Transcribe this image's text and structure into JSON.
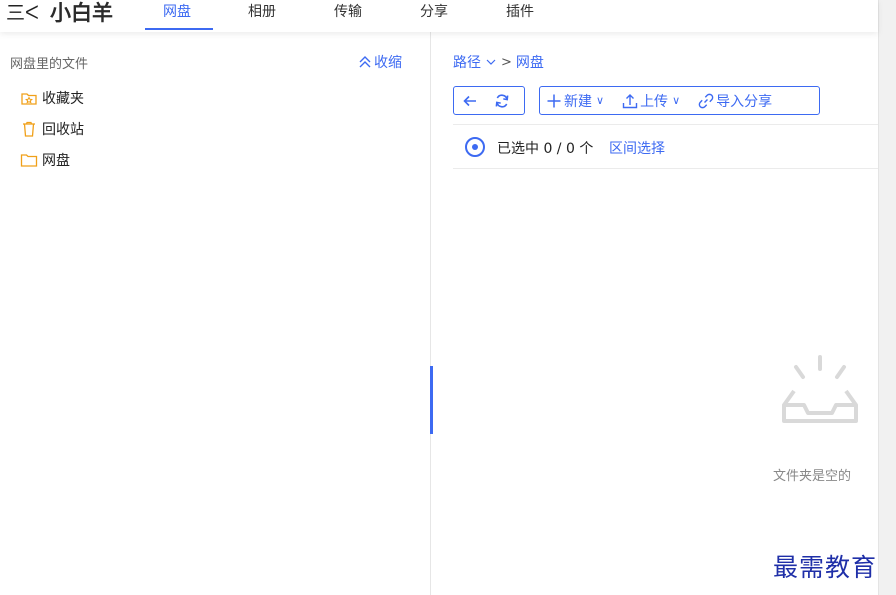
{
  "header": {
    "menu_icon": "三ᐸ",
    "brand": "小白羊",
    "tabs": [
      {
        "label": "网盘",
        "active": true
      },
      {
        "label": "相册"
      },
      {
        "label": "传输"
      },
      {
        "label": "分享"
      },
      {
        "label": "插件"
      }
    ]
  },
  "sidebar": {
    "title": "网盘里的文件",
    "collapse_label": "收缩",
    "items": [
      {
        "label": "收藏夹",
        "icon": "favorites-folder-icon"
      },
      {
        "label": "回收站",
        "icon": "trash-icon"
      },
      {
        "label": "网盘",
        "icon": "folder-icon"
      }
    ]
  },
  "breadcrumb": {
    "path_label": "路径",
    "current": "网盘"
  },
  "toolbar": {
    "new_label": "新建",
    "upload_label": "上传",
    "import_share_label": "导入分享"
  },
  "selection": {
    "status": "已选中 0 / 0 个",
    "range_select": "区间选择"
  },
  "empty_state": {
    "message": "文件夹是空的"
  },
  "watermark": "最需教育",
  "colors": {
    "accent": "#3d6af2",
    "folder": "#f0a019"
  }
}
